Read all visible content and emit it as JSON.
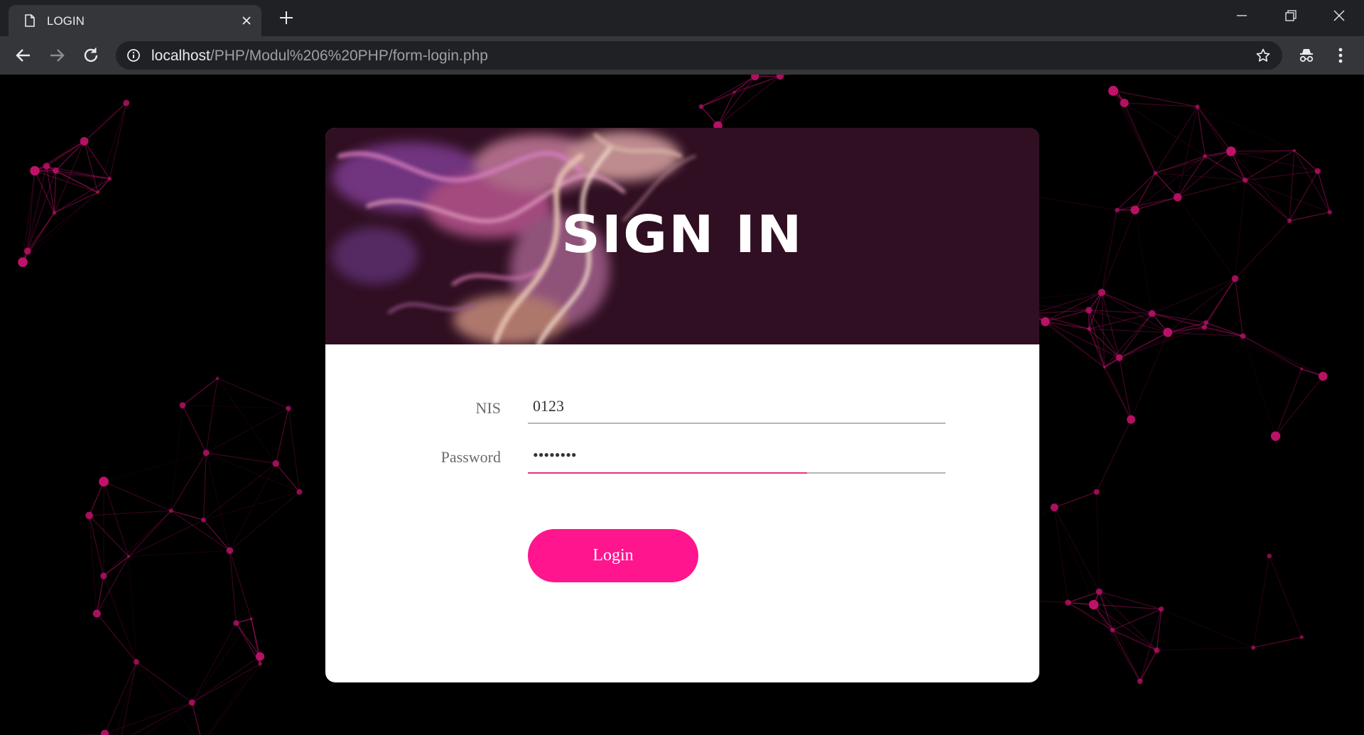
{
  "browser": {
    "tab_title": "LOGIN",
    "url_host": "localhost",
    "url_path": "/PHP/Modul%206%20PHP/form-login.php",
    "icons": {
      "tab": "page-icon",
      "close": "close-icon",
      "new_tab": "plus-icon",
      "back": "arrow-left-icon",
      "forward": "arrow-right-icon",
      "reload": "reload-icon",
      "info": "info-icon",
      "bookmark": "star-icon",
      "incognito": "incognito-icon",
      "menu": "kebab-menu-icon"
    }
  },
  "login_card": {
    "title": "SIGN IN",
    "fields": [
      {
        "label": "NIS",
        "value": "0123"
      },
      {
        "label": "Password",
        "value": "12345678"
      }
    ],
    "submit_label": "Login"
  },
  "colors": {
    "accent": "#ff158e",
    "banner": "#300f22",
    "network": "#c2126b"
  }
}
